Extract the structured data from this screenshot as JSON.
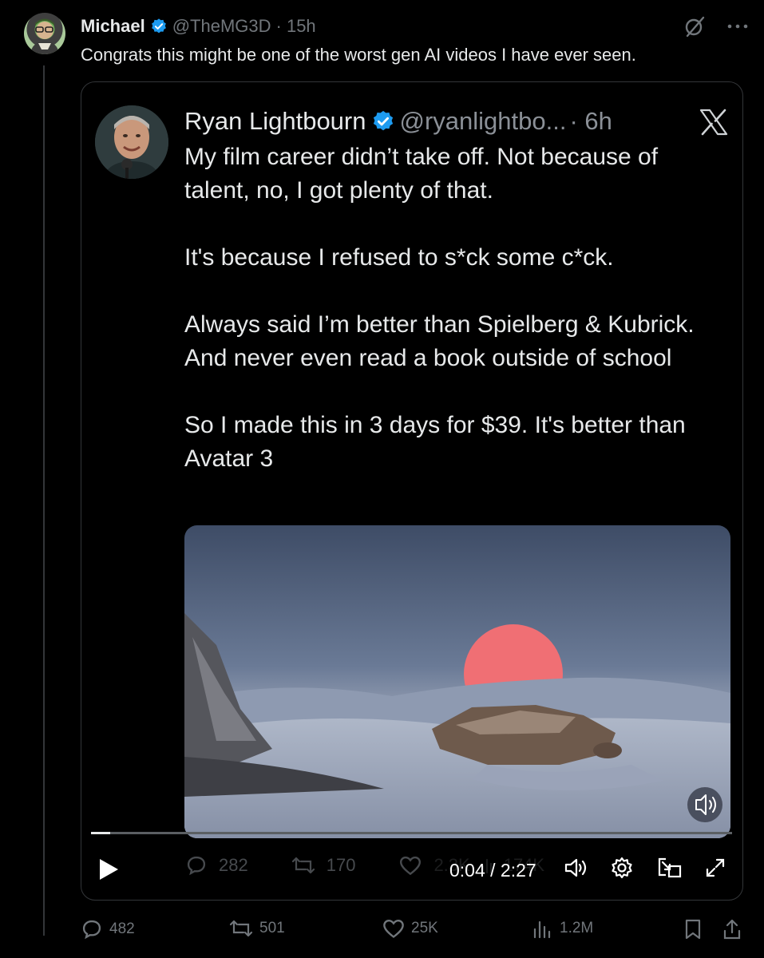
{
  "post": {
    "author_name": "Michael",
    "author_handle": "@TheMG3D",
    "time": "· 15h",
    "text": "Congrats this might be one of the worst gen AI videos I have ever seen."
  },
  "quoted": {
    "author_name": "Ryan Lightbourn",
    "author_handle": "@ryanlightbo...",
    "time": "· 6h",
    "paragraphs": [
      "My film career didn’t take off. Not because of talent, no, I got plenty of that.",
      "It's because I refused to s*ck some c*ck.",
      "Always said I’m better than Spielberg & Kubrick. And never even read a book outside of school",
      "So I made this in 3 days for $39. It's better than Avatar 3"
    ],
    "ghost_stats": {
      "replies": "282",
      "reposts": "170",
      "likes": "2.3K",
      "views": "174K"
    }
  },
  "video": {
    "time": "0:04 / 2:27",
    "progress": 0.03
  },
  "actions": {
    "replies": "482",
    "reposts": "501",
    "likes": "25K",
    "views": "1.2M"
  },
  "icons": {
    "accent": "#1d9bf0",
    "muted": "#71767b"
  }
}
